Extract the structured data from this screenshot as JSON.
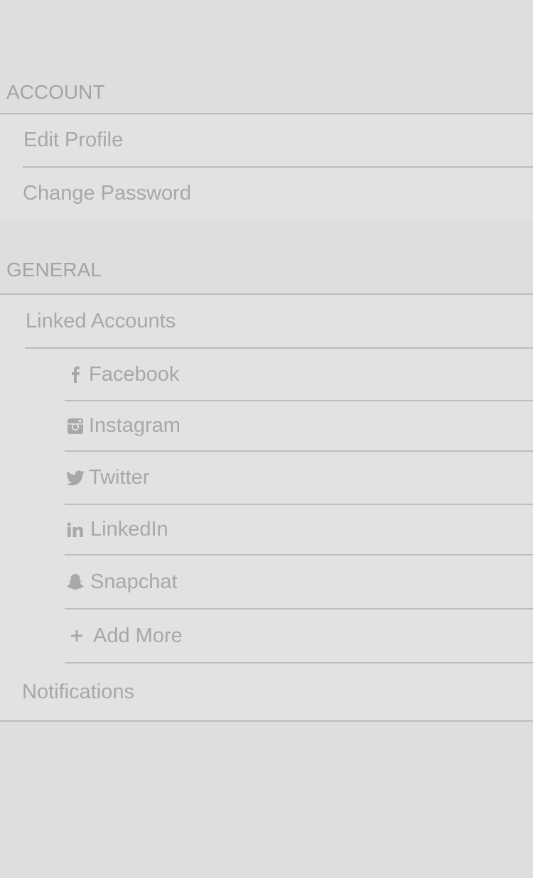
{
  "account": {
    "header": "ACCOUNT",
    "items": [
      {
        "label": "Edit Profile"
      },
      {
        "label": "Change Password"
      }
    ]
  },
  "general": {
    "header": "GENERAL",
    "linked_accounts": {
      "label": "Linked Accounts",
      "items": [
        {
          "label": "Facebook",
          "icon": "facebook-icon"
        },
        {
          "label": "Instagram",
          "icon": "instagram-icon"
        },
        {
          "label": "Twitter",
          "icon": "twitter-icon"
        },
        {
          "label": "LinkedIn",
          "icon": "linkedin-icon"
        },
        {
          "label": "Snapchat",
          "icon": "snapchat-icon"
        },
        {
          "label": "Add More",
          "icon": "plus-icon"
        }
      ]
    },
    "notifications": {
      "label": "Notifications"
    }
  },
  "colors": {
    "background": "#dedede",
    "row_background": "#e2e2e2",
    "text": "#a8a8a8",
    "divider": "#bdbdbd"
  }
}
